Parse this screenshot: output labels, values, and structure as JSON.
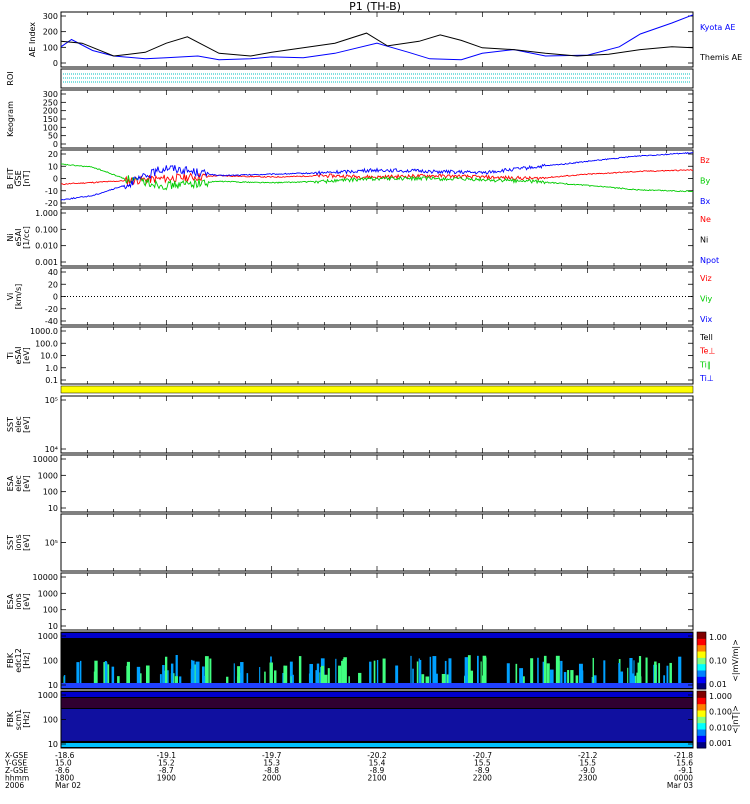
{
  "title": "P1 (TH-B)",
  "colors": {
    "black": "#000000",
    "blue": "#0000ff",
    "red": "#ff0000",
    "green": "#00cc00",
    "cyan": "#00c0c0",
    "yellow": "#ffff00",
    "fbk_background": "#000000",
    "fbk_band_low": "#00a0ff",
    "fbk_band_mid": "#40ff80",
    "fbk_band_top": "#0000cc"
  },
  "colorbar": {
    "colors": [
      "#00007f",
      "#0000ff",
      "#0080ff",
      "#00ffff",
      "#80ff80",
      "#ffff00",
      "#ff8000",
      "#ff0000",
      "#7f0000"
    ],
    "fbk1_ticks": [
      "1.00",
      "0.10",
      "0.01"
    ],
    "fbk1_label": "<|mV/m|>",
    "fbk2_ticks": [
      "1.000",
      "0.100",
      "0.010",
      "0.001"
    ],
    "fbk2_label": "<|nT|>"
  },
  "footer": {
    "row_labels": [
      "X-GSE",
      "Y-GSE",
      "Z-GSE",
      "hhmm",
      "2006"
    ],
    "ticks": [
      {
        "x": "-18.6",
        "y": "15.0",
        "z": "-8.6",
        "hhmm": "1800",
        "date": "Mar 02"
      },
      {
        "x": "-19.1",
        "y": "15.2",
        "z": "-8.7",
        "hhmm": "1900",
        "date": ""
      },
      {
        "x": "-19.7",
        "y": "15.3",
        "z": "-8.8",
        "hhmm": "2000",
        "date": ""
      },
      {
        "x": "-20.2",
        "y": "15.4",
        "z": "-8.9",
        "hhmm": "2100",
        "date": ""
      },
      {
        "x": "-20.7",
        "y": "15.5",
        "z": "-8.9",
        "hhmm": "2200",
        "date": ""
      },
      {
        "x": "-21.2",
        "y": "15.5",
        "z": "-9.0",
        "hhmm": "2300",
        "date": ""
      },
      {
        "x": "-21.8",
        "y": "15.6",
        "z": "-9.1",
        "hhmm": "0000",
        "date": "Mar 03"
      }
    ]
  },
  "chart_data": [
    {
      "type": "line",
      "panel": "ae",
      "ylabel": "AE Index",
      "yticks": [
        "300",
        "200",
        "100",
        "0"
      ],
      "ylim": [
        0,
        300
      ],
      "series": [
        {
          "name": "Kyota AE",
          "color": "blue",
          "x": [
            0,
            0.1,
            0.3,
            0.5,
            0.8,
            1.0,
            1.3,
            1.5,
            1.8,
            2.0,
            2.3,
            2.6,
            3.0,
            3.3,
            3.5,
            3.8,
            4.0,
            4.3,
            4.6,
            5.0,
            5.3,
            5.5,
            5.8,
            6.0
          ],
          "y": [
            110,
            150,
            90,
            60,
            45,
            50,
            60,
            40,
            45,
            55,
            50,
            75,
            130,
            80,
            45,
            40,
            75,
            95,
            60,
            65,
            110,
            180,
            240,
            285
          ]
        },
        {
          "name": "Themis AE",
          "color": "black",
          "x": [
            0,
            0.2,
            0.5,
            0.8,
            1.0,
            1.2,
            1.5,
            1.8,
            2.0,
            2.3,
            2.6,
            2.9,
            3.1,
            3.4,
            3.6,
            3.8,
            4.0,
            4.3,
            4.6,
            4.9,
            5.2,
            5.5,
            5.8,
            6.0
          ],
          "y": [
            140,
            130,
            60,
            80,
            130,
            165,
            75,
            60,
            80,
            105,
            130,
            185,
            115,
            140,
            175,
            145,
            105,
            95,
            75,
            60,
            70,
            95,
            110,
            105
          ]
        }
      ]
    },
    {
      "type": "line",
      "panel": "bfit",
      "ylabel": "B_FIT",
      "ylabel2": "GSE",
      "yunit": "[nT]",
      "yticks": [
        "20",
        "10",
        "0",
        "-10",
        "-20"
      ],
      "ylim": [
        -20,
        20
      ],
      "series": [
        {
          "name": "Bz",
          "color": "red",
          "x": [
            0,
            0.5,
            1.0,
            1.5,
            2.0,
            2.5,
            3.0,
            3.5,
            4.0,
            4.5,
            5.0,
            5.5,
            6.0
          ],
          "y": [
            -4,
            -2,
            0,
            2,
            1,
            2,
            1,
            2,
            1,
            0,
            3,
            5,
            6
          ]
        },
        {
          "name": "By",
          "color": "green",
          "x": [
            0,
            0.3,
            0.6,
            1.0,
            1.5,
            2.0,
            2.5,
            3.0,
            3.5,
            4.0,
            4.5,
            5.0,
            5.5,
            6.0
          ],
          "y": [
            10,
            8,
            0,
            -5,
            -2,
            -3,
            -2,
            0,
            0,
            -1,
            -2,
            -5,
            -8,
            -9
          ]
        },
        {
          "name": "Bx",
          "color": "blue",
          "x": [
            0,
            0.3,
            0.6,
            1.0,
            1.5,
            2.0,
            2.5,
            3.0,
            3.5,
            4.0,
            4.5,
            5.0,
            5.5,
            6.0
          ],
          "y": [
            -15,
            -12,
            -5,
            8,
            2,
            3,
            4,
            6,
            5,
            4,
            8,
            12,
            16,
            18
          ]
        }
      ]
    }
  ],
  "panels": {
    "roi": {
      "ylabel": "ROI"
    },
    "keogram": {
      "ylabel": "Keogram",
      "yticks": [
        "300",
        "250",
        "200",
        "150",
        "100",
        "50",
        "0"
      ]
    },
    "ni": {
      "ylabel": "Ni",
      "ylabel2": "eSAI",
      "yunit": "[1/cc]",
      "yticks": [
        "1.000",
        "0.100",
        "0.010",
        "0.001"
      ],
      "legend": [
        "Ne",
        "Ni",
        "Npot"
      ],
      "legend_colors": [
        "red",
        "black",
        "blue"
      ]
    },
    "vi": {
      "ylabel": "Vi",
      "yunit": "[km/s]",
      "yticks": [
        "40",
        "20",
        "0",
        "-20",
        "-40"
      ],
      "legend": [
        "Viz",
        "Viy",
        "Vix"
      ],
      "legend_colors": [
        "red",
        "green",
        "blue"
      ]
    },
    "ti": {
      "ylabel": "Ti",
      "ylabel2": "eSAI",
      "yunit": "[eV]",
      "yticks": [
        "1000.0",
        "100.0",
        "10.0",
        "1.0",
        "0.1"
      ],
      "legend": [
        "Tell",
        "Te⊥",
        "Ti∥",
        "Ti⊥"
      ],
      "legend_colors": [
        "black",
        "red",
        "green",
        "blue"
      ]
    },
    "sst_e": {
      "ylabel": "SST",
      "ylabel2": "elec",
      "yunit": "[eV]",
      "yticks": [
        "10⁵",
        "10⁴"
      ]
    },
    "esa_e": {
      "ylabel": "ESA",
      "ylabel2": "elec",
      "yunit": "[eV]",
      "yticks": [
        "10000",
        "1000",
        "100",
        "10"
      ]
    },
    "sst_i": {
      "ylabel": "SST",
      "ylabel2": "ions",
      "yunit": "[eV]",
      "yticks": [
        "10⁵"
      ]
    },
    "esa_i": {
      "ylabel": "ESA",
      "ylabel2": "ions",
      "yunit": "[eV]",
      "yticks": [
        "10000",
        "1000",
        "100",
        "10"
      ]
    },
    "fbk1": {
      "ylabel": "FBK",
      "ylabel2": "edc12",
      "yunit": "[Hz]",
      "yticks": [
        "1000",
        "100",
        "10"
      ]
    },
    "fbk2": {
      "ylabel": "FBK",
      "ylabel2": "scm1",
      "yunit": "[Hz]",
      "yticks": [
        "1000",
        "100",
        "10"
      ]
    }
  }
}
